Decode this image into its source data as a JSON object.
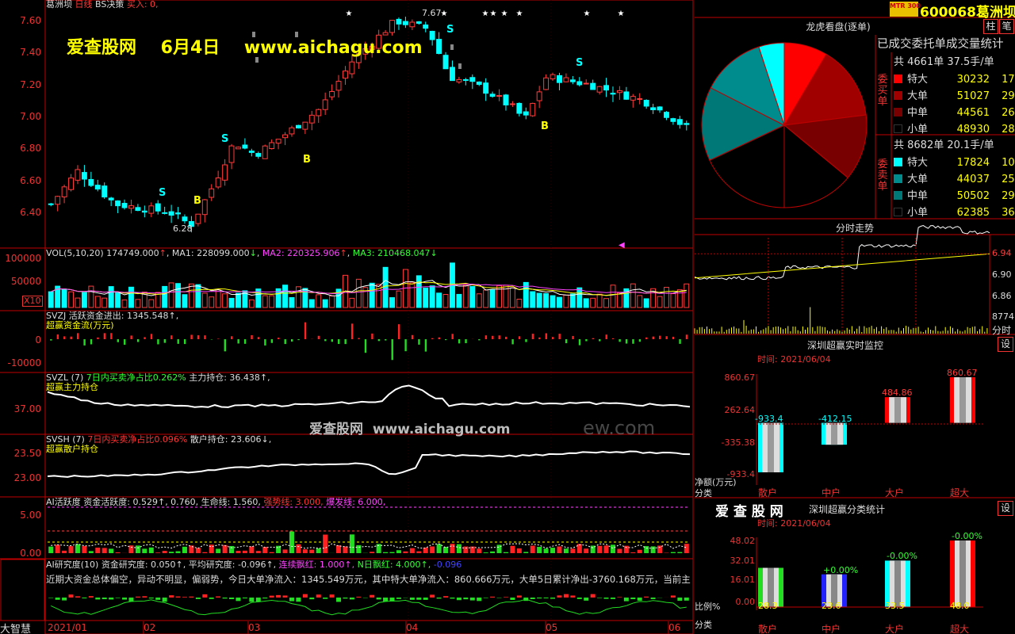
{
  "header": {
    "stock_name": "葛洲坝",
    "period": "日线",
    "strategy": "BS决策",
    "signal": "买入: 0,",
    "watermark_top": "爱查股网    6月4日    www.aichagu.com",
    "watermark_mid": "爱查股网  www.aichagu.com",
    "watermark_ghost": "ew.com",
    "price_high_label": "7.67",
    "price_low_label": "6.28"
  },
  "main_chart": {
    "y_ticks": [
      "7.60",
      "7.40",
      "7.20",
      "7.00",
      "6.80",
      "6.60",
      "6.40"
    ],
    "x_ticks": [
      "2021/01",
      "02",
      "03",
      "04",
      "05",
      "06"
    ],
    "signal_labels": [
      "S",
      "B",
      "S",
      "B",
      "S",
      "B",
      "S"
    ]
  },
  "vol_panel": {
    "title": "VOL(5,10,20) 174749.000↑, MA1: 228099.000↓, MA2: 220325.906↑, MA3: 210468.047↓",
    "parts": {
      "vol": "VOL(5,10,20) 174749.000",
      "ma1": "MA1: 228099.000",
      "ma2": "MA2: 220325.906",
      "ma3": "MA3: 210468.047"
    },
    "y_ticks": [
      "100000",
      "50000"
    ],
    "unit": "X10"
  },
  "svzj_panel": {
    "title": "SVZJ  活跃资金进出: 1345.548↑,",
    "subtitle": "超赢资金流(万元)",
    "y_ticks": [
      "0",
      "-10000"
    ]
  },
  "svzl_panel": {
    "prefix": "SVZL (7)",
    "ratio": "7日内买卖净占比0.262%",
    "main": "主力持仓: 36.438↑,",
    "subtitle": "超赢主力持仓",
    "y_ticks": [
      "37.00"
    ]
  },
  "svsh_panel": {
    "prefix": "SVSH (7)",
    "ratio": "7日内买卖净占比0.096%",
    "main": "散户持仓: 23.606↓,",
    "subtitle": "超赢散户持仓",
    "y_ticks": [
      "23.50",
      "23.00"
    ]
  },
  "ai_panel": {
    "prefix": "AI活跃度",
    "fund": "资金活跃度: 0.529↑, 0.760,",
    "life": "生命线: 1.560,",
    "strong": "强势线: 3.000,",
    "burst": "爆发线: 6.000,",
    "y_ticks": [
      "5.00",
      "0.00"
    ]
  },
  "research_panel": {
    "prefix": "AI研究度(10)",
    "fund": "资金研究度: 0.050↑,",
    "avg": "平均研究度: -0.096↑,",
    "red": "连续飘红: 1.000↑,",
    "n_red": "N日飘红: 4.000↑,",
    "last": "-0.096",
    "summary": "近期大资金总体偏空，异动不明显，偏弱势，今日大单净流入：1345.549万元，其中特大单净流入：860.666万元，大单5日累计净出-3760.168万元，当前主"
  },
  "logo_corner": "大智慧",
  "right_header": {
    "badge": "MTR 300",
    "code": "600068",
    "name": "葛洲坝",
    "btn_1": "柱",
    "btn_2": "笔"
  },
  "dragon_panel": {
    "title": "龙虎看盘(逐单)",
    "subtitle": "已成交委托单成交量统计",
    "buy_side_label": "委买单",
    "sell_side_label": "委卖单",
    "buy_total": "共 4661单 37.5手/单",
    "sell_total": "共 8682单 20.1手/单",
    "buy_rows": [
      {
        "label": "特大",
        "value": "30232",
        "pct": "17%",
        "color": "#ff0000"
      },
      {
        "label": "大单",
        "value": "51027",
        "pct": "29%",
        "color": "#a00000"
      },
      {
        "label": "中单",
        "value": "44561",
        "pct": "26%",
        "color": "#780000"
      },
      {
        "label": "小单",
        "value": "48930",
        "pct": "28%",
        "color": "#000000"
      }
    ],
    "sell_rows": [
      {
        "label": "特大",
        "value": "17824",
        "pct": "10%",
        "color": "#00ffff"
      },
      {
        "label": "大单",
        "value": "44037",
        "pct": "25%",
        "color": "#008c8c"
      },
      {
        "label": "中单",
        "value": "50502",
        "pct": "29%",
        "color": "#007878"
      },
      {
        "label": "小单",
        "value": "62385",
        "pct": "36%",
        "color": "#000000"
      }
    ],
    "pie_series": [
      17,
      29,
      26,
      28,
      36,
      29,
      25,
      10
    ]
  },
  "intraday_panel": {
    "title": "分时走势",
    "y_ticks": [
      "6.94",
      "6.90",
      "6.86"
    ],
    "vol_label": "8774",
    "time_label": "分时"
  },
  "monitor_panel": {
    "title": "深圳超赢实时监控",
    "settings": "设",
    "time": "时间: 2021/06/04",
    "y_ticks": [
      "860.67",
      "262.64",
      "-335.38",
      "-933.4"
    ],
    "y_label_1": "净额(万元)",
    "y_label_2": "分类",
    "chart_data": {
      "type": "bar",
      "categories": [
        "散户",
        "中户",
        "大户",
        "超大"
      ],
      "values": [
        -933.4,
        -412.15,
        484.86,
        860.67
      ],
      "ylim": [
        -933.4,
        860.67
      ]
    },
    "value_labels": [
      "-933.4",
      "-412.15",
      "484.86",
      "860.67"
    ]
  },
  "class_panel": {
    "title": "深圳超赢分类统计",
    "brand": "爱 查 股 网",
    "settings": "设",
    "time": "时间: 2021/06/04",
    "y_ticks": [
      "48.02",
      "32.01",
      "16.01",
      "0.00"
    ],
    "y_label_1": "比例%",
    "y_label_2": "分类",
    "chart_data": {
      "type": "bar",
      "categories": [
        "散户",
        "中户",
        "大户",
        "超大"
      ],
      "values": [
        28.3,
        23.6,
        33.5,
        48.0
      ],
      "ylim": [
        0,
        48.02
      ]
    },
    "change_labels": [
      "",
      "+0.00%",
      "-0.00%",
      "-0.00%"
    ],
    "value_labels": [
      "28.3",
      "23.6",
      "33.5",
      "48.0"
    ]
  }
}
